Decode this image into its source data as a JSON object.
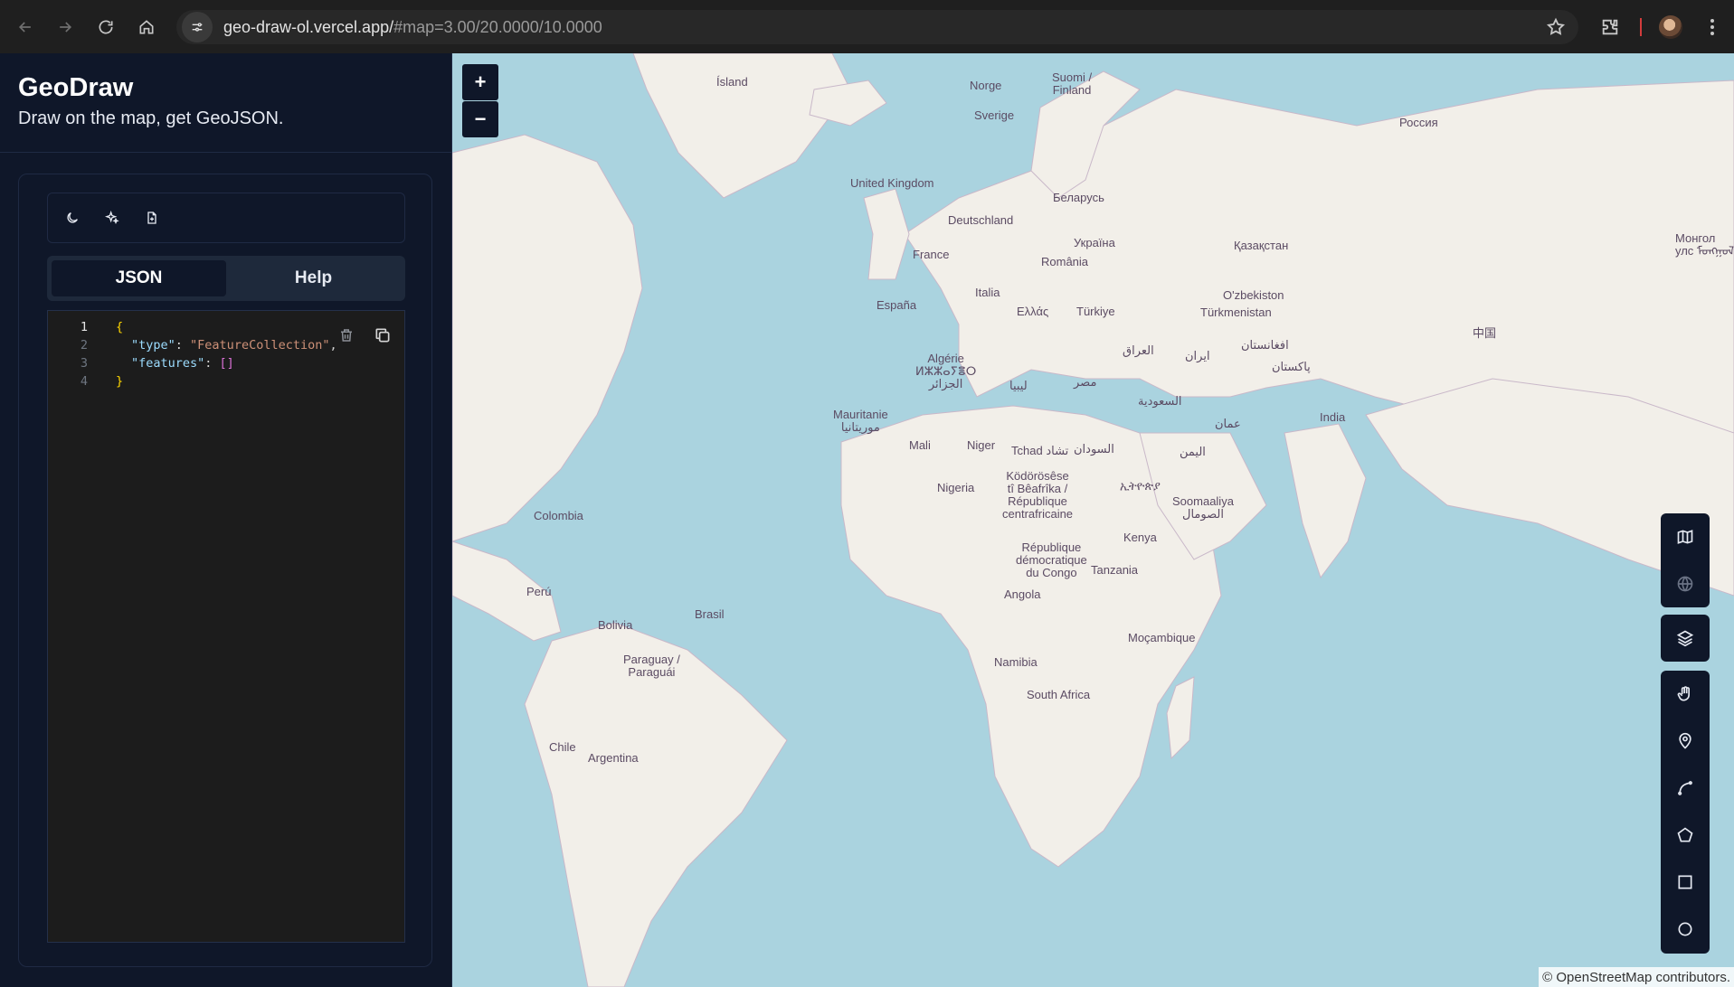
{
  "browser": {
    "url_host": "geo-draw-ol.vercel.app/",
    "url_rest": "#map=3.00/20.0000/10.0000"
  },
  "sidebar": {
    "title": "GeoDraw",
    "subtitle": "Draw on the map, get GeoJSON.",
    "toolbar": {
      "icons": [
        "moon-icon",
        "sparkles-icon",
        "file-import-icon"
      ]
    },
    "tabs": [
      {
        "label": "JSON",
        "active": true
      },
      {
        "label": "Help",
        "active": false
      }
    ],
    "editor": {
      "line_numbers": [
        "1",
        "2",
        "3",
        "4"
      ],
      "lines": [
        [
          "{"
        ],
        [
          "\"type\"",
          ": ",
          "\"FeatureCollection\"",
          ","
        ],
        [
          "\"features\"",
          ": ",
          "[]"
        ],
        [
          "}"
        ]
      ]
    }
  },
  "map": {
    "zoom_in": "+",
    "zoom_out": "−",
    "attribution": "© OpenStreetMap contributors.",
    "labels": [
      "Ísland",
      "Norge",
      "Suomi /\nFinland",
      "Sverige",
      "Россия",
      "United Kingdom",
      "Беларусь",
      "Deutschland",
      "Україна",
      "Қазақстан",
      "Монгол\nулс ᠮᠣᠩᠭᠣᠯ",
      "France",
      "România",
      "Italia",
      "O'zbekiston",
      "España",
      "Ελλάς",
      "Türkiye",
      "Türkmenistan",
      "العراق",
      "افغانستان",
      "ایران",
      "中国",
      "Algérie\nⵍⵣⵣⴰⵢⴻⵔ\nالجزائر",
      "ليبيا",
      "مصر",
      "پاکستان",
      "السعودية",
      "عمان",
      "India",
      "Mauritanie\nموريتانيا",
      "Mali",
      "Niger",
      "Tchad تشاد",
      "السودان",
      "اليمن",
      "Nigeria",
      "Ködörösêse\ntî Bêafrîka /\nRépublique\ncentrafricaine",
      "ኢትዮጵያ",
      "Soomaaliya\nالصومال",
      "Kenya",
      "République\ndémocratique\ndu Congo",
      "Tanzania",
      "Angola",
      "Moçambique",
      "Namibia",
      "South Africa",
      "Colombia",
      "Perú",
      "Brasil",
      "Bolivia",
      "Paraguay /\nParaguái",
      "Chile",
      "Argentina"
    ]
  },
  "colors": {
    "sidebar_bg": "#0f1729",
    "water": "#aad3df",
    "land": "#f2efe9",
    "border": "#1f2a44"
  }
}
